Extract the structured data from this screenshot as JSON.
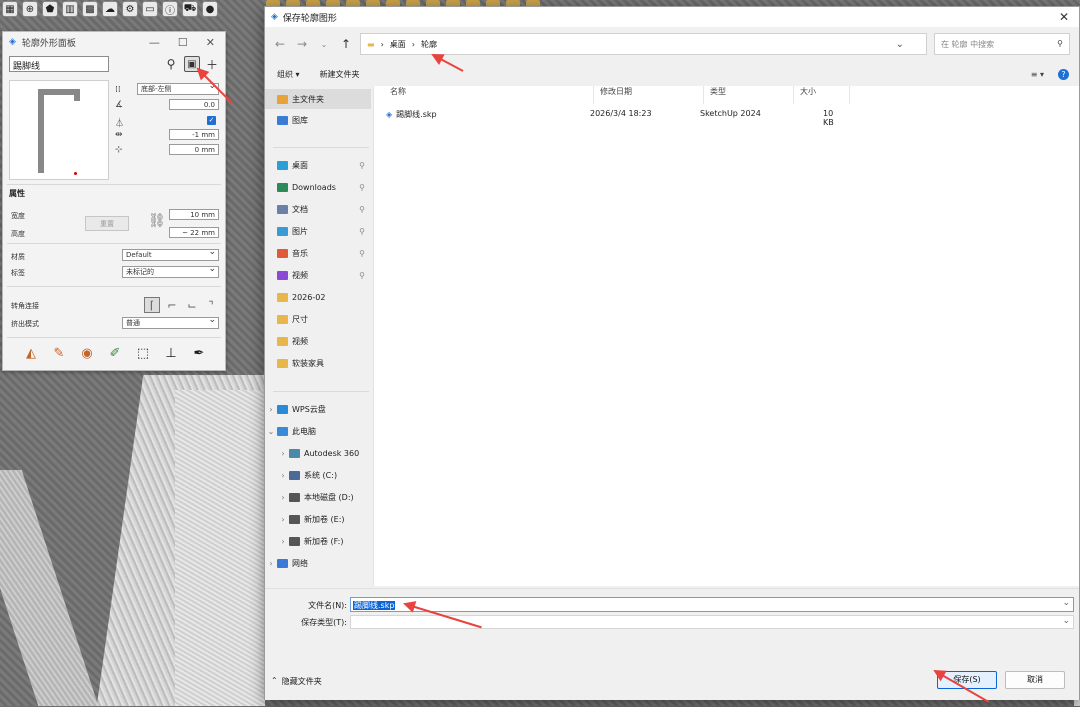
{
  "toolbar": {
    "icons": [
      "grid-icon",
      "add-icon",
      "badge-icon",
      "building-icon",
      "checker-icon",
      "cloud-icon",
      "gear-icon",
      "folder-icon",
      "info-icon",
      "cart-icon",
      "user-icon"
    ]
  },
  "panel": {
    "title": "轮廓外形面板",
    "name_value": "踢脚线",
    "anchor_select": "底部-左侧",
    "angle_value": "0.0",
    "offset_x": "-1 mm",
    "offset_y": "0 mm",
    "section_attributes": "属性",
    "width_label": "宽度",
    "height_label": "高度",
    "reset_label": "重置",
    "width_value": "10 mm",
    "height_value": "~ 22 mm",
    "material_label": "材质",
    "material_value": "Default",
    "tag_label": "标签",
    "tag_value": "未标记的",
    "corner_label": "转角连接",
    "extrude_label": "挤出模式",
    "extrude_value": "普通"
  },
  "dialog": {
    "title": "保存轮廓图形",
    "breadcrumb": [
      "桌面",
      "轮廓"
    ],
    "search_placeholder": "在 轮廓 中搜索",
    "organize": "组织 ▾",
    "new_folder": "新建文件夹",
    "sidebar": [
      {
        "label": "主文件夹",
        "sel": true
      },
      {
        "label": "图库"
      },
      {
        "label": "桌面",
        "pin": true
      },
      {
        "label": "Downloads",
        "pin": true
      },
      {
        "label": "文档",
        "pin": true
      },
      {
        "label": "图片",
        "pin": true
      },
      {
        "label": "音乐",
        "pin": true
      },
      {
        "label": "视频",
        "pin": true
      },
      {
        "label": "2026-02"
      },
      {
        "label": "尺寸"
      },
      {
        "label": "视频"
      },
      {
        "label": "软装家具"
      },
      {
        "label": "WPS云盘"
      },
      {
        "label": "此电脑"
      },
      {
        "label": "Autodesk 360"
      },
      {
        "label": "系统 (C:)"
      },
      {
        "label": "本地磁盘 (D:)"
      },
      {
        "label": "新加卷 (E:)"
      },
      {
        "label": "新加卷 (F:)"
      },
      {
        "label": "网络"
      }
    ],
    "columns": [
      "名称",
      "修改日期",
      "类型",
      "大小"
    ],
    "files": [
      {
        "name": "踢脚线.skp",
        "date": "2026/3/4 18:23",
        "type": "SketchUp 2024",
        "size": "10 KB"
      }
    ],
    "filename_label": "文件名(N):",
    "filename_value": "踢脚线.skp",
    "filetype_label": "保存类型(T):",
    "hide_folders": "隐藏文件夹",
    "save_button": "保存(S)",
    "cancel_button": "取消"
  }
}
